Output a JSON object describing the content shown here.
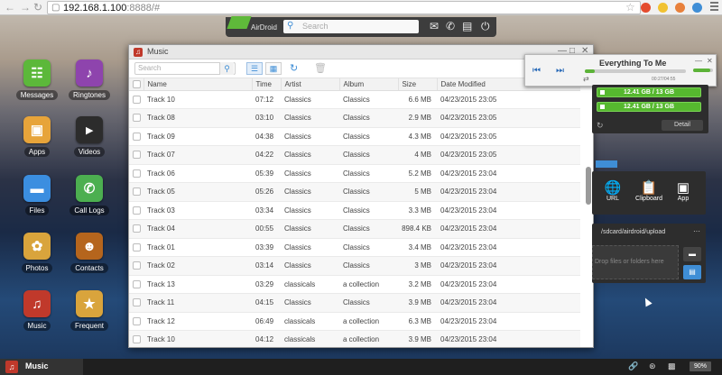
{
  "browser": {
    "url_host": "192.168.1.100",
    "url_rest": ":8888/#"
  },
  "topbar": {
    "brand": "AirDroid",
    "search_placeholder": "Search"
  },
  "desktop": {
    "icons": [
      {
        "label": "Messages",
        "icon": "message-icon",
        "color": "#5cb83a"
      },
      {
        "label": "Ringtones",
        "icon": "music-note-icon",
        "color": "#8e44ad"
      },
      {
        "label": "Apps",
        "icon": "box-icon",
        "color": "#e7a43a"
      },
      {
        "label": "Videos",
        "icon": "clapper-icon",
        "color": "#2c2c2c"
      },
      {
        "label": "Files",
        "icon": "folder-icon",
        "color": "#3b8ee0"
      },
      {
        "label": "Call Logs",
        "icon": "phone-icon",
        "color": "#4caf50"
      },
      {
        "label": "Photos",
        "icon": "photo-icon",
        "color": "#d9a43c"
      },
      {
        "label": "Contacts",
        "icon": "contacts-icon",
        "color": "#b5651d"
      },
      {
        "label": "Music",
        "icon": "music-icon",
        "color": "#c0392b"
      },
      {
        "label": "Frequent",
        "icon": "frequent-icon",
        "color": "#d9a43c"
      }
    ]
  },
  "music_window": {
    "title": "Music",
    "search_placeholder": "Search",
    "columns": [
      "Name",
      "Time",
      "Artist",
      "Album",
      "Size",
      "Date Modified"
    ],
    "rows": [
      {
        "name": "Track 10",
        "time": "07:12",
        "artist": "Classics",
        "album": "Classics",
        "size": "6.6 MB",
        "date": "04/23/2015 23:05"
      },
      {
        "name": "Track 08",
        "time": "03:10",
        "artist": "Classics",
        "album": "Classics",
        "size": "2.9 MB",
        "date": "04/23/2015 23:05"
      },
      {
        "name": "Track 09",
        "time": "04:38",
        "artist": "Classics",
        "album": "Classics",
        "size": "4.3 MB",
        "date": "04/23/2015 23:05"
      },
      {
        "name": "Track 07",
        "time": "04:22",
        "artist": "Classics",
        "album": "Classics",
        "size": "4 MB",
        "date": "04/23/2015 23:05"
      },
      {
        "name": "Track 06",
        "time": "05:39",
        "artist": "Classics",
        "album": "Classics",
        "size": "5.2 MB",
        "date": "04/23/2015 23:04"
      },
      {
        "name": "Track 05",
        "time": "05:26",
        "artist": "Classics",
        "album": "Classics",
        "size": "5 MB",
        "date": "04/23/2015 23:04"
      },
      {
        "name": "Track 03",
        "time": "03:34",
        "artist": "Classics",
        "album": "Classics",
        "size": "3.3 MB",
        "date": "04/23/2015 23:04"
      },
      {
        "name": "Track 04",
        "time": "00:55",
        "artist": "Classics",
        "album": "Classics",
        "size": "898.4 KB",
        "date": "04/23/2015 23:04"
      },
      {
        "name": "Track 01",
        "time": "03:39",
        "artist": "Classics",
        "album": "Classics",
        "size": "3.4 MB",
        "date": "04/23/2015 23:04"
      },
      {
        "name": "Track 02",
        "time": "03:14",
        "artist": "Classics",
        "album": "Classics",
        "size": "3 MB",
        "date": "04/23/2015 23:04"
      },
      {
        "name": "Track 13",
        "time": "03:29",
        "artist": "classicals",
        "album": "a collection",
        "size": "3.2 MB",
        "date": "04/23/2015 23:04"
      },
      {
        "name": "Track 11",
        "time": "04:15",
        "artist": "Classics",
        "album": "Classics",
        "size": "3.9 MB",
        "date": "04/23/2015 23:04"
      },
      {
        "name": "Track 12",
        "time": "06:49",
        "artist": "classicals",
        "album": "a collection",
        "size": "6.3 MB",
        "date": "04/23/2015 23:04"
      },
      {
        "name": "Track 10",
        "time": "04:12",
        "artist": "classicals",
        "album": "a collection",
        "size": "3.9 MB",
        "date": "04/23/2015 23:04"
      }
    ]
  },
  "player": {
    "title": "Everything To Me",
    "time": "00:27/04:55",
    "progress": 0.1,
    "volume": 0.85
  },
  "storage": {
    "bar1": "12.41 GB / 13 GB",
    "bar2": "12.41 GB / 13 GB",
    "detail_label": "Detail"
  },
  "tools": {
    "url_label": "URL",
    "clipboard_label": "Clipboard",
    "app_label": "App"
  },
  "upload": {
    "path": "/sdcard/airdroid/upload",
    "drop_text": "Drop files or folders here"
  },
  "taskbar": {
    "app_label": "Music",
    "battery": "90%"
  }
}
